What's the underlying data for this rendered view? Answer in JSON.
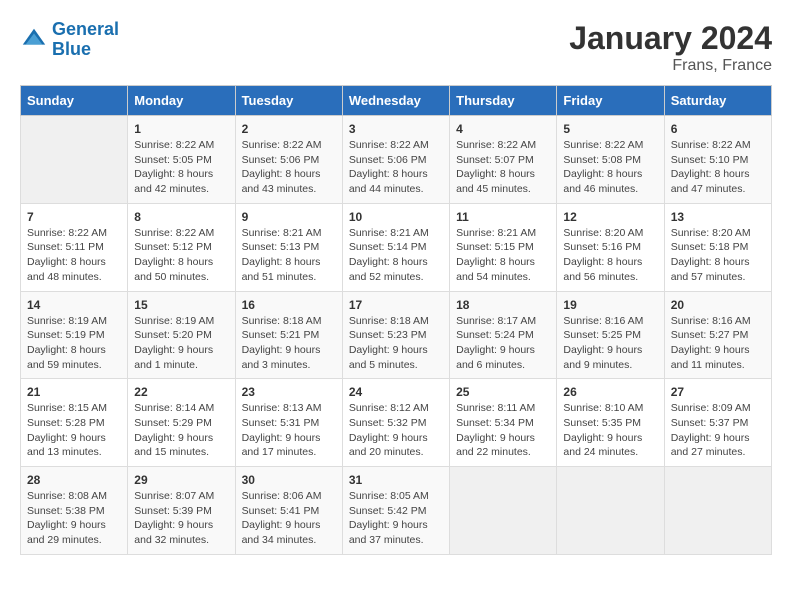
{
  "header": {
    "logo_line1": "General",
    "logo_line2": "Blue",
    "title": "January 2024",
    "subtitle": "Frans, France"
  },
  "days_of_week": [
    "Sunday",
    "Monday",
    "Tuesday",
    "Wednesday",
    "Thursday",
    "Friday",
    "Saturday"
  ],
  "weeks": [
    [
      {
        "num": "",
        "info": ""
      },
      {
        "num": "1",
        "info": "Sunrise: 8:22 AM\nSunset: 5:05 PM\nDaylight: 8 hours\nand 42 minutes."
      },
      {
        "num": "2",
        "info": "Sunrise: 8:22 AM\nSunset: 5:06 PM\nDaylight: 8 hours\nand 43 minutes."
      },
      {
        "num": "3",
        "info": "Sunrise: 8:22 AM\nSunset: 5:06 PM\nDaylight: 8 hours\nand 44 minutes."
      },
      {
        "num": "4",
        "info": "Sunrise: 8:22 AM\nSunset: 5:07 PM\nDaylight: 8 hours\nand 45 minutes."
      },
      {
        "num": "5",
        "info": "Sunrise: 8:22 AM\nSunset: 5:08 PM\nDaylight: 8 hours\nand 46 minutes."
      },
      {
        "num": "6",
        "info": "Sunrise: 8:22 AM\nSunset: 5:10 PM\nDaylight: 8 hours\nand 47 minutes."
      }
    ],
    [
      {
        "num": "7",
        "info": "Sunrise: 8:22 AM\nSunset: 5:11 PM\nDaylight: 8 hours\nand 48 minutes."
      },
      {
        "num": "8",
        "info": "Sunrise: 8:22 AM\nSunset: 5:12 PM\nDaylight: 8 hours\nand 50 minutes."
      },
      {
        "num": "9",
        "info": "Sunrise: 8:21 AM\nSunset: 5:13 PM\nDaylight: 8 hours\nand 51 minutes."
      },
      {
        "num": "10",
        "info": "Sunrise: 8:21 AM\nSunset: 5:14 PM\nDaylight: 8 hours\nand 52 minutes."
      },
      {
        "num": "11",
        "info": "Sunrise: 8:21 AM\nSunset: 5:15 PM\nDaylight: 8 hours\nand 54 minutes."
      },
      {
        "num": "12",
        "info": "Sunrise: 8:20 AM\nSunset: 5:16 PM\nDaylight: 8 hours\nand 56 minutes."
      },
      {
        "num": "13",
        "info": "Sunrise: 8:20 AM\nSunset: 5:18 PM\nDaylight: 8 hours\nand 57 minutes."
      }
    ],
    [
      {
        "num": "14",
        "info": "Sunrise: 8:19 AM\nSunset: 5:19 PM\nDaylight: 8 hours\nand 59 minutes."
      },
      {
        "num": "15",
        "info": "Sunrise: 8:19 AM\nSunset: 5:20 PM\nDaylight: 9 hours\nand 1 minute."
      },
      {
        "num": "16",
        "info": "Sunrise: 8:18 AM\nSunset: 5:21 PM\nDaylight: 9 hours\nand 3 minutes."
      },
      {
        "num": "17",
        "info": "Sunrise: 8:18 AM\nSunset: 5:23 PM\nDaylight: 9 hours\nand 5 minutes."
      },
      {
        "num": "18",
        "info": "Sunrise: 8:17 AM\nSunset: 5:24 PM\nDaylight: 9 hours\nand 6 minutes."
      },
      {
        "num": "19",
        "info": "Sunrise: 8:16 AM\nSunset: 5:25 PM\nDaylight: 9 hours\nand 9 minutes."
      },
      {
        "num": "20",
        "info": "Sunrise: 8:16 AM\nSunset: 5:27 PM\nDaylight: 9 hours\nand 11 minutes."
      }
    ],
    [
      {
        "num": "21",
        "info": "Sunrise: 8:15 AM\nSunset: 5:28 PM\nDaylight: 9 hours\nand 13 minutes."
      },
      {
        "num": "22",
        "info": "Sunrise: 8:14 AM\nSunset: 5:29 PM\nDaylight: 9 hours\nand 15 minutes."
      },
      {
        "num": "23",
        "info": "Sunrise: 8:13 AM\nSunset: 5:31 PM\nDaylight: 9 hours\nand 17 minutes."
      },
      {
        "num": "24",
        "info": "Sunrise: 8:12 AM\nSunset: 5:32 PM\nDaylight: 9 hours\nand 20 minutes."
      },
      {
        "num": "25",
        "info": "Sunrise: 8:11 AM\nSunset: 5:34 PM\nDaylight: 9 hours\nand 22 minutes."
      },
      {
        "num": "26",
        "info": "Sunrise: 8:10 AM\nSunset: 5:35 PM\nDaylight: 9 hours\nand 24 minutes."
      },
      {
        "num": "27",
        "info": "Sunrise: 8:09 AM\nSunset: 5:37 PM\nDaylight: 9 hours\nand 27 minutes."
      }
    ],
    [
      {
        "num": "28",
        "info": "Sunrise: 8:08 AM\nSunset: 5:38 PM\nDaylight: 9 hours\nand 29 minutes."
      },
      {
        "num": "29",
        "info": "Sunrise: 8:07 AM\nSunset: 5:39 PM\nDaylight: 9 hours\nand 32 minutes."
      },
      {
        "num": "30",
        "info": "Sunrise: 8:06 AM\nSunset: 5:41 PM\nDaylight: 9 hours\nand 34 minutes."
      },
      {
        "num": "31",
        "info": "Sunrise: 8:05 AM\nSunset: 5:42 PM\nDaylight: 9 hours\nand 37 minutes."
      },
      {
        "num": "",
        "info": ""
      },
      {
        "num": "",
        "info": ""
      },
      {
        "num": "",
        "info": ""
      }
    ]
  ]
}
